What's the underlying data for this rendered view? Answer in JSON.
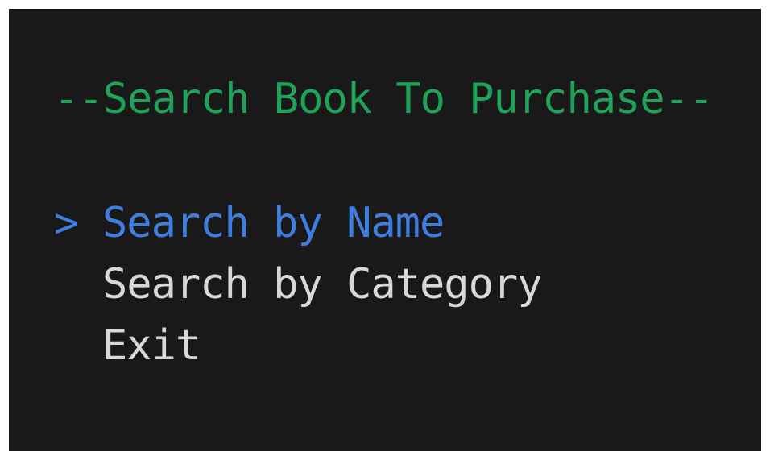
{
  "prompt": {
    "title": "--Search Book To Purchase--"
  },
  "menu": {
    "cursor_glyph": ">",
    "selected_index": 0,
    "items": [
      {
        "label": "Search by Name"
      },
      {
        "label": "Search by Category"
      },
      {
        "label": "Exit"
      }
    ]
  },
  "colors": {
    "background": "#191919",
    "page": "#ffffff",
    "title": "#1fa35a",
    "selected": "#3f7ee0",
    "normal": "#d8d8d8"
  }
}
